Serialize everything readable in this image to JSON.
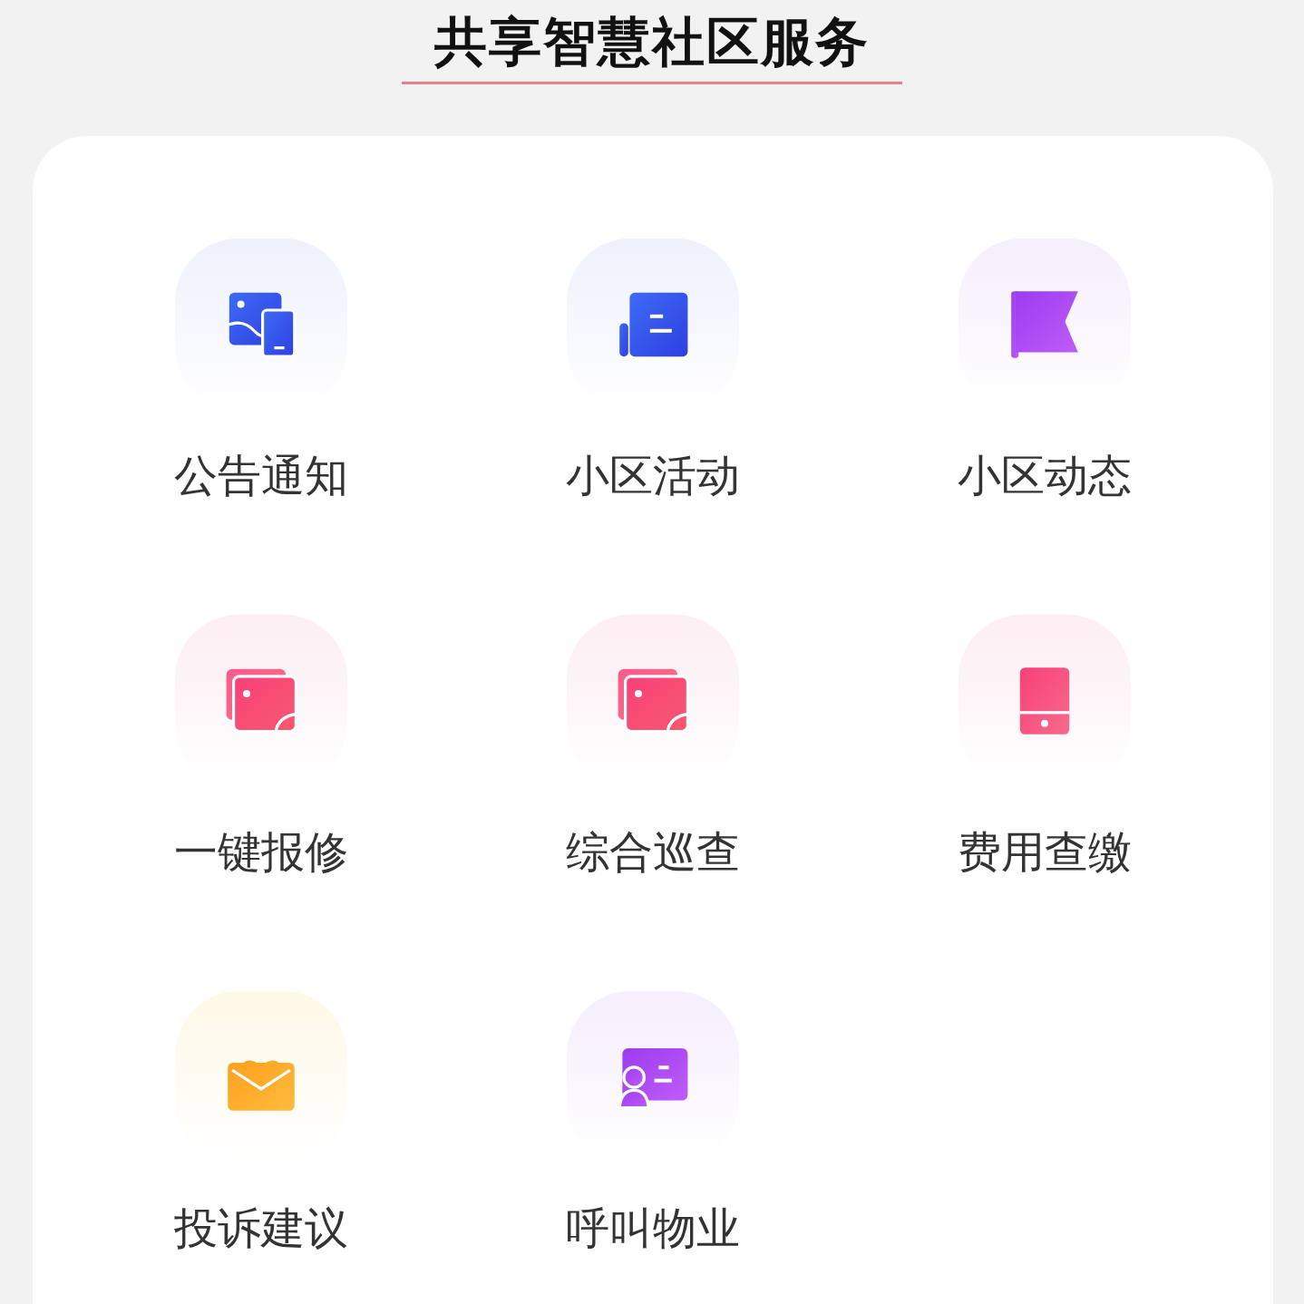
{
  "title": "共享智慧社区服务",
  "services": [
    {
      "label": "公告通知",
      "kind": "notice"
    },
    {
      "label": "小区活动",
      "kind": "activity"
    },
    {
      "label": "小区动态",
      "kind": "news"
    },
    {
      "label": "一键报修",
      "kind": "repair"
    },
    {
      "label": "综合巡查",
      "kind": "inspection"
    },
    {
      "label": "费用查缴",
      "kind": "fee"
    },
    {
      "label": "投诉建议",
      "kind": "complaint"
    },
    {
      "label": "呼叫物业",
      "kind": "call"
    }
  ]
}
